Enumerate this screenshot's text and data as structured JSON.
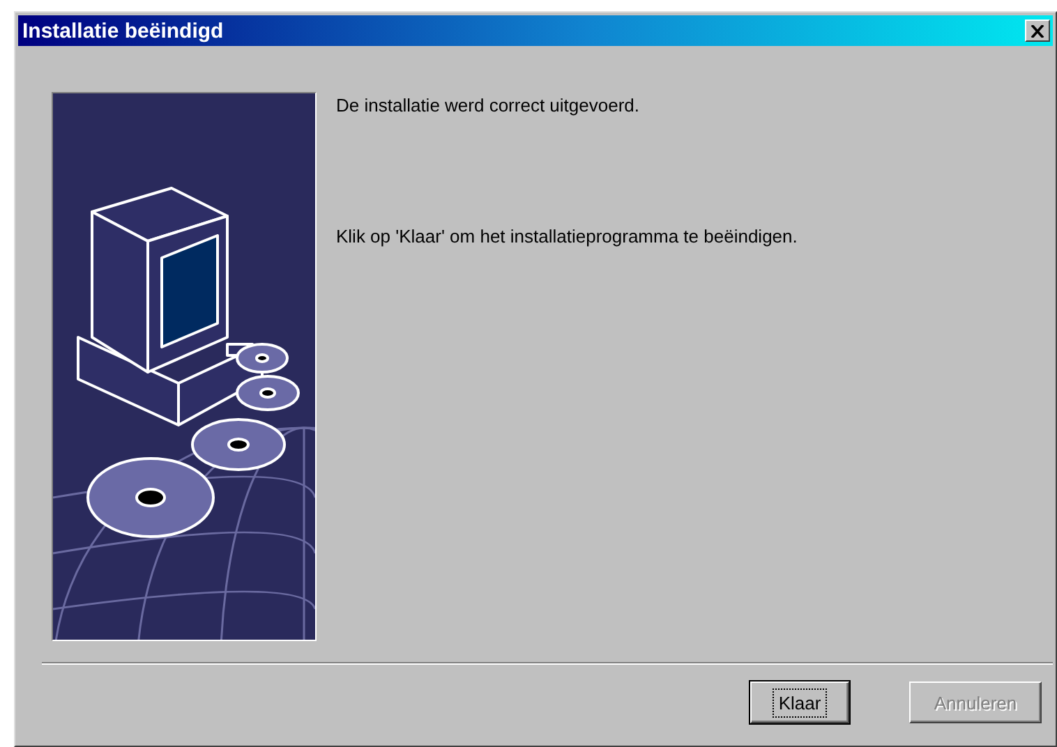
{
  "window": {
    "title": "Installatie beëindigd"
  },
  "messages": [
    "De installatie werd correct uitgevoerd.",
    "Klik op 'Klaar' om het installatieprogramma te beëindigen."
  ],
  "buttons": [
    {
      "label": "Klaar",
      "default": true,
      "disabled": false
    },
    {
      "label": "Annuleren",
      "default": false,
      "disabled": true
    }
  ]
}
